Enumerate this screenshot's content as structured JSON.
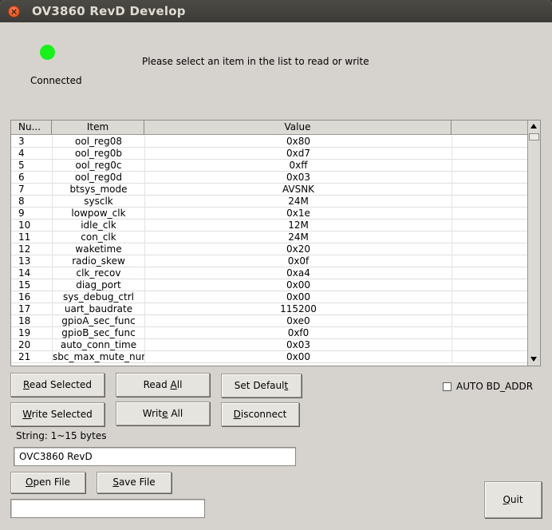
{
  "window": {
    "title": "OV3860 RevD Develop"
  },
  "status": {
    "label": "Connected",
    "color": "#1af01a"
  },
  "hint": "Please select an item in the list to read or write",
  "table": {
    "columns": [
      "Nu...",
      "Item",
      "Value",
      ""
    ],
    "rows": [
      {
        "num": "3",
        "item": "ool_reg08",
        "value": "0x80"
      },
      {
        "num": "4",
        "item": "ool_reg0b",
        "value": "0xd7"
      },
      {
        "num": "5",
        "item": "ool_reg0c",
        "value": "0xff"
      },
      {
        "num": "6",
        "item": "ool_reg0d",
        "value": "0x03"
      },
      {
        "num": "7",
        "item": "btsys_mode",
        "value": "AVSNK"
      },
      {
        "num": "8",
        "item": "sysclk",
        "value": "24M"
      },
      {
        "num": "9",
        "item": "lowpow_clk",
        "value": "0x1e"
      },
      {
        "num": "10",
        "item": "idle_clk",
        "value": "12M"
      },
      {
        "num": "11",
        "item": "con_clk",
        "value": "24M"
      },
      {
        "num": "12",
        "item": "waketime",
        "value": "0x20"
      },
      {
        "num": "13",
        "item": "radio_skew",
        "value": "0x0f"
      },
      {
        "num": "14",
        "item": "clk_recov",
        "value": "0xa4"
      },
      {
        "num": "15",
        "item": "diag_port",
        "value": "0x00"
      },
      {
        "num": "16",
        "item": "sys_debug_ctrl",
        "value": "0x00"
      },
      {
        "num": "17",
        "item": "uart_baudrate",
        "value": "115200"
      },
      {
        "num": "18",
        "item": "gpioA_sec_func",
        "value": "0xe0"
      },
      {
        "num": "19",
        "item": "gpioB_sec_func",
        "value": "0xf0"
      },
      {
        "num": "20",
        "item": "auto_conn_time",
        "value": "0x03"
      },
      {
        "num": "21",
        "item": "sbc_max_mute_num",
        "value": "0x00"
      }
    ]
  },
  "buttons": {
    "read_selected": {
      "mnemonic": "R",
      "rest": "ead Selected"
    },
    "read_all": {
      "pre": "Read ",
      "mnemonic": "A",
      "post": "ll"
    },
    "set_default": {
      "pre": "Set Defaul",
      "mnemonic": "t",
      "post": ""
    },
    "write_selected": {
      "mnemonic": "W",
      "rest": "rite Selected"
    },
    "write_all": {
      "pre": "Writ",
      "mnemonic": "e",
      "post": " All"
    },
    "disconnect": {
      "mnemonic": "D",
      "rest": "isconnect"
    },
    "open_file": {
      "mnemonic": "O",
      "rest": "pen File"
    },
    "save_file": {
      "mnemonic": "S",
      "rest": "ave File"
    },
    "quit": {
      "mnemonic": "Q",
      "rest": "uit"
    }
  },
  "auto_bd_addr": {
    "label": "AUTO BD_ADDR",
    "checked": false
  },
  "string_field": {
    "label": "String: 1~15 bytes",
    "value": "OVC3860 RevD"
  },
  "file_path": {
    "value": ""
  }
}
